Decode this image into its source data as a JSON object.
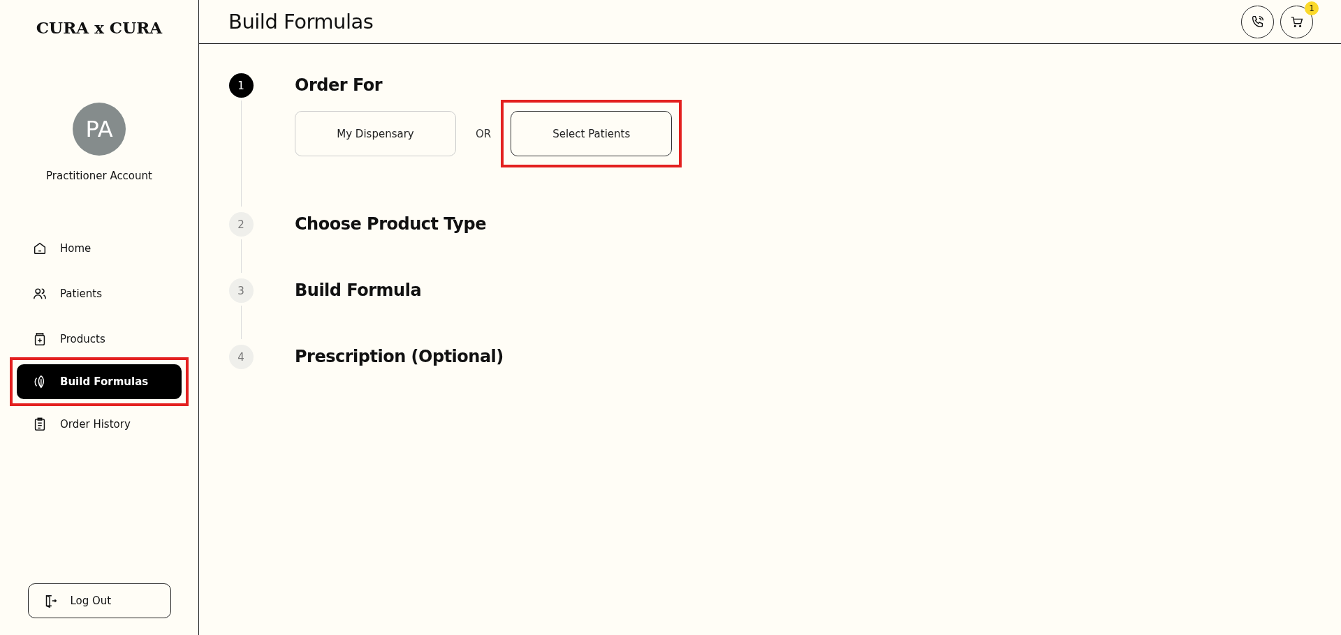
{
  "sidebar": {
    "logo": "CURA x CURA",
    "avatar_initials": "PA",
    "account_name": "Practitioner Account",
    "items": [
      {
        "label": "Home",
        "kind": "home",
        "selected": false,
        "highlighted": false
      },
      {
        "label": "Patients",
        "kind": "people",
        "selected": false,
        "highlighted": false
      },
      {
        "label": "Products",
        "kind": "jar",
        "selected": false,
        "highlighted": false
      },
      {
        "label": "Build Formulas",
        "kind": "leaf",
        "selected": true,
        "highlighted": true
      },
      {
        "label": "Order History",
        "kind": "clipboard",
        "selected": false,
        "highlighted": false
      }
    ],
    "logout": "Log Out"
  },
  "header": {
    "title": "Build Formulas",
    "cart_badge": "1"
  },
  "steps": [
    {
      "number": "1",
      "title": "Order For",
      "active": true,
      "options": [
        {
          "label": "My Dispensary",
          "selected": false,
          "highlighted": false
        },
        {
          "label": "Select Patients",
          "selected": true,
          "highlighted": true
        }
      ],
      "separator": "OR"
    },
    {
      "number": "2",
      "title": "Choose Product Type",
      "active": false
    },
    {
      "number": "3",
      "title": "Build Formula",
      "active": false
    },
    {
      "number": "4",
      "title": "Prescription (Optional)",
      "active": false
    }
  ]
}
